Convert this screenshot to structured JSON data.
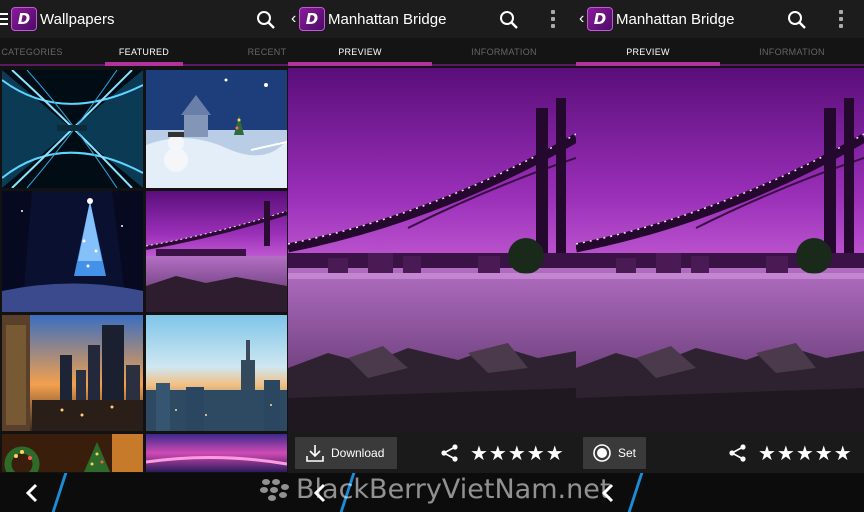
{
  "panel1": {
    "title": "Wallpapers",
    "logo_letter": "D",
    "tabs": [
      {
        "label": "CATEGORIES",
        "active": false
      },
      {
        "label": "FEATURED",
        "active": true
      },
      {
        "label": "RECENT",
        "active": false
      }
    ],
    "thumbnails": [
      {
        "name": "blue-abstract-x"
      },
      {
        "name": "snowy-village-snowman"
      },
      {
        "name": "lit-christmas-tree-night"
      },
      {
        "name": "manhattan-bridge-purple"
      },
      {
        "name": "city-skyscrapers-sunset"
      },
      {
        "name": "empire-state-skyline-blue"
      },
      {
        "name": "christmas-wreath-lights"
      },
      {
        "name": "pink-sunset-sky"
      }
    ]
  },
  "panel2": {
    "title": "Manhattan Bridge",
    "logo_letter": "D",
    "tabs": [
      {
        "label": "PREVIEW",
        "active": true
      },
      {
        "label": "INFORMATION",
        "active": false
      }
    ],
    "action_label": "Download",
    "stars": "★★★★★"
  },
  "panel3": {
    "title": "Manhattan Bridge",
    "logo_letter": "D",
    "tabs": [
      {
        "label": "PREVIEW",
        "active": true
      },
      {
        "label": "INFORMATION",
        "active": false
      }
    ],
    "action_label": "Set",
    "stars": "★★★★★"
  },
  "watermark": "BlackBerryVietNam.net",
  "colors": {
    "accent": "#b3339e",
    "slash": "#1a8cd8",
    "bar": "#1c1c1c"
  },
  "icons": [
    "menu-icon",
    "search-icon",
    "kebab-icon",
    "back-icon",
    "download-icon",
    "share-icon",
    "radio-icon",
    "star-icon"
  ]
}
